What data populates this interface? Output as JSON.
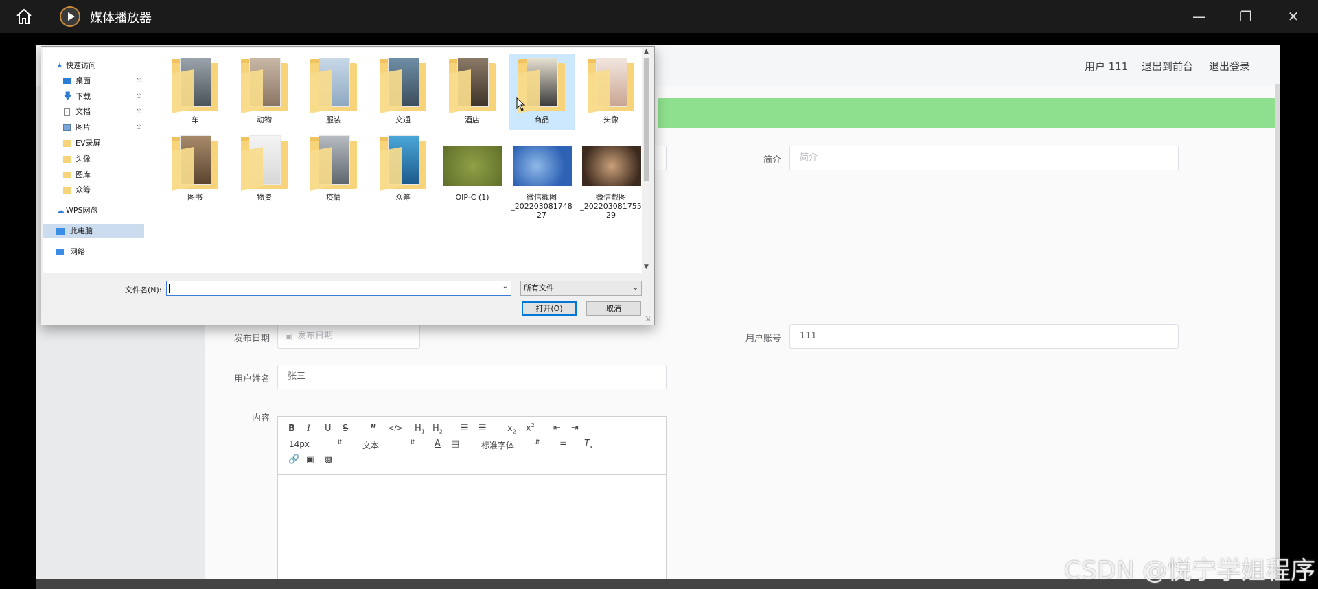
{
  "window": {
    "title": "媒体播放器"
  },
  "app": {
    "header": {
      "user_label": "用户 111",
      "frontend_link": "退出到前台",
      "logout_link": "退出登录"
    },
    "form": {
      "intro_label": "简介",
      "intro_placeholder": "简介",
      "publish_date_label": "发布日期",
      "publish_date_placeholder": "发布日期",
      "user_account_label": "用户账号",
      "user_account_value": "111",
      "user_name_label": "用户姓名",
      "user_name_value": "张三",
      "content_label": "内容"
    },
    "editor": {
      "font_size": "14px",
      "block_type": "文本",
      "font_family": "标准字体"
    }
  },
  "dialog": {
    "nav": [
      {
        "label": "快速访问",
        "icon": "star-icon"
      },
      {
        "label": "桌面",
        "icon": "desktop-icon",
        "pinned": true
      },
      {
        "label": "下载",
        "icon": "download-icon",
        "pinned": true
      },
      {
        "label": "文档",
        "icon": "document-icon",
        "pinned": true
      },
      {
        "label": "图片",
        "icon": "picture-icon",
        "pinned": true
      },
      {
        "label": "EV录屏",
        "icon": "folder-icon"
      },
      {
        "label": "头像",
        "icon": "folder-icon"
      },
      {
        "label": "图库",
        "icon": "folder-icon"
      },
      {
        "label": "众筹",
        "icon": "folder-icon"
      },
      {
        "label": "WPS网盘",
        "icon": "cloud-icon"
      },
      {
        "label": "此电脑",
        "icon": "computer-icon",
        "selected": true
      },
      {
        "label": "网络",
        "icon": "network-icon"
      }
    ],
    "files": [
      {
        "name": "车",
        "kind": "folder"
      },
      {
        "name": "动物",
        "kind": "folder"
      },
      {
        "name": "服装",
        "kind": "folder"
      },
      {
        "name": "交通",
        "kind": "folder"
      },
      {
        "name": "酒店",
        "kind": "folder"
      },
      {
        "name": "商品",
        "kind": "folder",
        "selected": true
      },
      {
        "name": "头像",
        "kind": "folder"
      },
      {
        "name": "图书",
        "kind": "folder"
      },
      {
        "name": "物资",
        "kind": "folder"
      },
      {
        "name": "疫情",
        "kind": "folder"
      },
      {
        "name": "众筹",
        "kind": "folder"
      },
      {
        "name": "OIP-C (1)",
        "kind": "image"
      },
      {
        "name": "微信截图\n_202203081748\n27",
        "kind": "image"
      },
      {
        "name": "微信截图\n_202203081755\n29",
        "kind": "image"
      }
    ],
    "filename_label": "文件名(N):",
    "filename_value": "",
    "file_type": "所有文件",
    "open_button": "打开(O)",
    "cancel_button": "取消"
  },
  "watermark": "CSDN @悦宁学姐程序",
  "colors": {
    "titlebar": "#1b1b1b",
    "banner": "#8ee08e",
    "folder": "#f7d37a",
    "selection": "#cce8ff",
    "focus": "#0078d7"
  }
}
